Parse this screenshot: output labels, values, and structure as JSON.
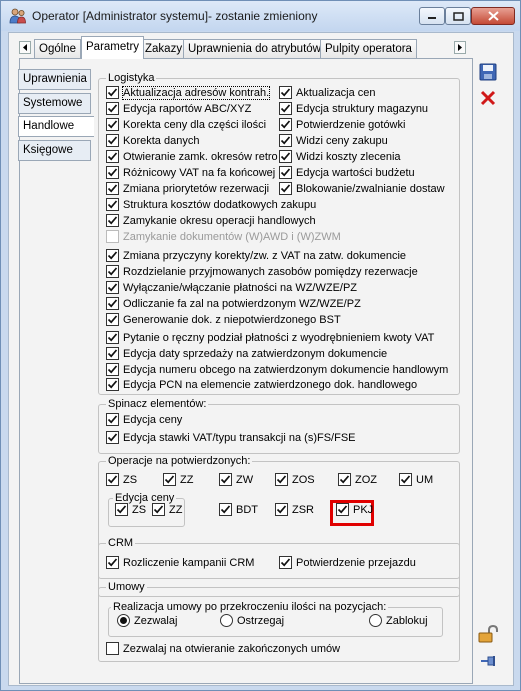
{
  "window": {
    "title": "Operator [Administrator systemu]- zostanie zmieniony",
    "colors": {
      "accent": "#c9d9ee",
      "close": "#c44a36",
      "highlight": "#e00000"
    }
  },
  "tabs": [
    "Ogólne",
    "Parametry",
    "Zakazy",
    "Uprawnienia do atrybutów",
    "Pulpity operatora"
  ],
  "active_tab": "Parametry",
  "side_tabs": [
    "Uprawnienia",
    "Systemowe",
    "Handlowe",
    "Księgowe"
  ],
  "active_side_tab": "Handlowe",
  "logistyka": {
    "title": "Logistyka",
    "left": [
      {
        "label": "Aktualizacja adresów kontrah.",
        "checked": true
      },
      {
        "label": "Edycja raportów ABC/XYZ",
        "checked": true
      },
      {
        "label": "Korekta ceny dla części ilości",
        "checked": true
      },
      {
        "label": "Korekta danych",
        "checked": true
      },
      {
        "label": "Otwieranie zamk. okresów retro",
        "checked": true
      },
      {
        "label": "Różnicowy VAT na fa końcowej",
        "checked": true
      },
      {
        "label": "Zmiana priorytetów rezerwacji",
        "checked": true
      }
    ],
    "right": [
      {
        "label": "Aktualizacja cen",
        "checked": true
      },
      {
        "label": "Edycja struktury magazynu",
        "checked": true
      },
      {
        "label": "Potwierdzenie gotówki",
        "checked": true
      },
      {
        "label": "Widzi ceny zakupu",
        "checked": true
      },
      {
        "label": "Widzi koszty zlecenia",
        "checked": true
      },
      {
        "label": "Edycja wartości budżetu",
        "checked": true
      },
      {
        "label": "Blokowanie/zwalnianie dostaw",
        "checked": true
      }
    ],
    "full": [
      {
        "label": "Struktura kosztów dodatkowych zakupu",
        "checked": true,
        "disabled": false
      },
      {
        "label": "Zamykanie okresu operacji handlowych",
        "checked": true,
        "disabled": false
      },
      {
        "label": "Zamykanie dokumentów (W)AWD i (W)ZWM",
        "checked": false,
        "disabled": true
      },
      {
        "label": "Zmiana przyczyny korekty/zw. z VAT na zatw. dokumencie",
        "checked": true,
        "disabled": false
      },
      {
        "label": "Rozdzielanie przyjmowanych zasobów pomiędzy rezerwacje",
        "checked": true,
        "disabled": false
      },
      {
        "label": "Wyłączanie/włączanie płatności na WZ/WZE/PZ",
        "checked": true,
        "disabled": false
      },
      {
        "label": "Odliczanie fa zal na potwierdzonym WZ/WZE/PZ",
        "checked": true,
        "disabled": false
      },
      {
        "label": "Generowanie dok. z niepotwierdzonego BST",
        "checked": true,
        "disabled": false
      },
      {
        "label": "Pytanie o ręczny podział płatności z wyodrębnieniem kwoty VAT",
        "checked": true,
        "disabled": false
      },
      {
        "label": "Edycja daty sprzedaży na zatwierdzonym dokumencie",
        "checked": true,
        "disabled": false
      },
      {
        "label": "Edycja numeru obcego na zatwierdzonym dokumencie handlowym",
        "checked": true,
        "disabled": false
      },
      {
        "label": "Edycja PCN na elemencie zatwierdzonego dok. handlowego",
        "checked": true,
        "disabled": false
      }
    ]
  },
  "spinacz": {
    "title": "Spinacz elementów:",
    "items": [
      {
        "label": "Edycja ceny",
        "checked": true
      },
      {
        "label": "Edycja stawki VAT/typu transakcji na (s)FS/FSE",
        "checked": true
      }
    ]
  },
  "operacje": {
    "title": "Operacje na potwierdzonych:",
    "row1": [
      {
        "label": "ZS",
        "checked": true
      },
      {
        "label": "ZZ",
        "checked": true
      },
      {
        "label": "ZW",
        "checked": true
      },
      {
        "label": "ZOS",
        "checked": true
      },
      {
        "label": "ZOZ",
        "checked": true
      },
      {
        "label": "UM",
        "checked": true
      }
    ],
    "edycja_ceny_title": "Edycja ceny",
    "edycja_ceny": [
      {
        "label": "ZS",
        "checked": true
      },
      {
        "label": "ZZ",
        "checked": true
      }
    ],
    "row2": [
      {
        "label": "BDT",
        "checked": true
      },
      {
        "label": "ZSR",
        "checked": true
      },
      {
        "label": "PKJ",
        "checked": true
      }
    ]
  },
  "crm": {
    "title": "CRM",
    "items": [
      {
        "label": "Rozliczenie kampanii CRM",
        "checked": true
      },
      {
        "label": "Potwierdzenie przejazdu",
        "checked": true
      }
    ]
  },
  "umowy": {
    "title": "Umowy",
    "realizacja_title": "Realizacja umowy po przekroczeniu ilości na pozycjach:",
    "options": [
      "Zezwalaj",
      "Ostrzegaj",
      "Zablokuj"
    ],
    "selected": "Zezwalaj",
    "otwieranie": {
      "label": "Zezwalaj na otwieranie zakończonych umów",
      "checked": false
    }
  },
  "icons": [
    "save-icon",
    "cancel-icon",
    "unlock-icon",
    "pin-icon"
  ]
}
